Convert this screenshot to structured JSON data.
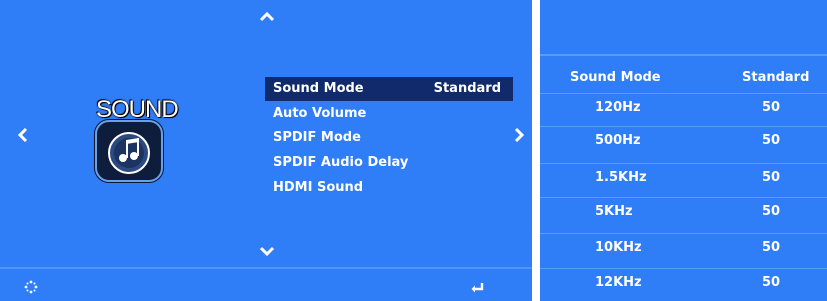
{
  "left_panel": {
    "title": "SOUND",
    "menu": [
      {
        "label": "Sound Mode",
        "value": "Standard",
        "selected": true
      },
      {
        "label": "Auto Volume",
        "value": ""
      },
      {
        "label": "SPDIF Mode",
        "value": ""
      },
      {
        "label": "SPDIF Audio Delay",
        "value": ""
      },
      {
        "label": "HDMI Sound",
        "value": ""
      }
    ],
    "icons": {
      "up": "chevron-up-icon",
      "down": "chevron-down-icon",
      "left": "chevron-left-icon",
      "right": "chevron-right-icon",
      "move": "move-icon",
      "enter": "enter-icon",
      "app": "music-note-icon"
    }
  },
  "right_panel": {
    "header": {
      "label": "Sound Mode",
      "value": "Standard"
    },
    "bands": [
      {
        "label": "120Hz",
        "value": "50"
      },
      {
        "label": "500Hz",
        "value": "50"
      },
      {
        "label": "1.5KHz",
        "value": "50"
      },
      {
        "label": "5KHz",
        "value": "50"
      },
      {
        "label": "10KHz",
        "value": "50"
      },
      {
        "label": "12KHz",
        "value": "50"
      }
    ]
  },
  "colors": {
    "background": "#2f7df7",
    "selected": "#102a6b",
    "text": "#ffffff"
  }
}
